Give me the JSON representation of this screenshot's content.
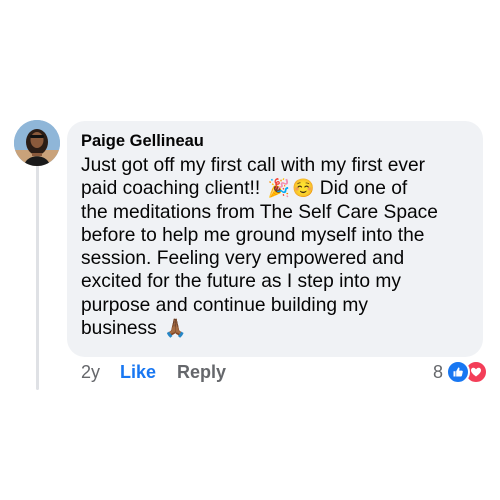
{
  "comment": {
    "author": "Paige Gellineau",
    "lines": [
      "Just got off my first call with my first ever",
      "paid coaching client!!",
      "Did one of",
      "the meditations from The Self Care Space",
      "before to help me ground myself into the",
      "session. Feeling very empowered and",
      "excited for the future as I step into my",
      "purpose and continue building my",
      "business"
    ],
    "emojis": {
      "party": "🎉",
      "smile": "☺️",
      "pray": "🙏🏾"
    }
  },
  "actions": {
    "time": "2y",
    "like_label": "Like",
    "reply_label": "Reply"
  },
  "reactions": {
    "count": "8",
    "types": [
      "like-icon",
      "love-icon"
    ],
    "colors": {
      "like": "#1877f2",
      "love": "#f33e58"
    }
  }
}
